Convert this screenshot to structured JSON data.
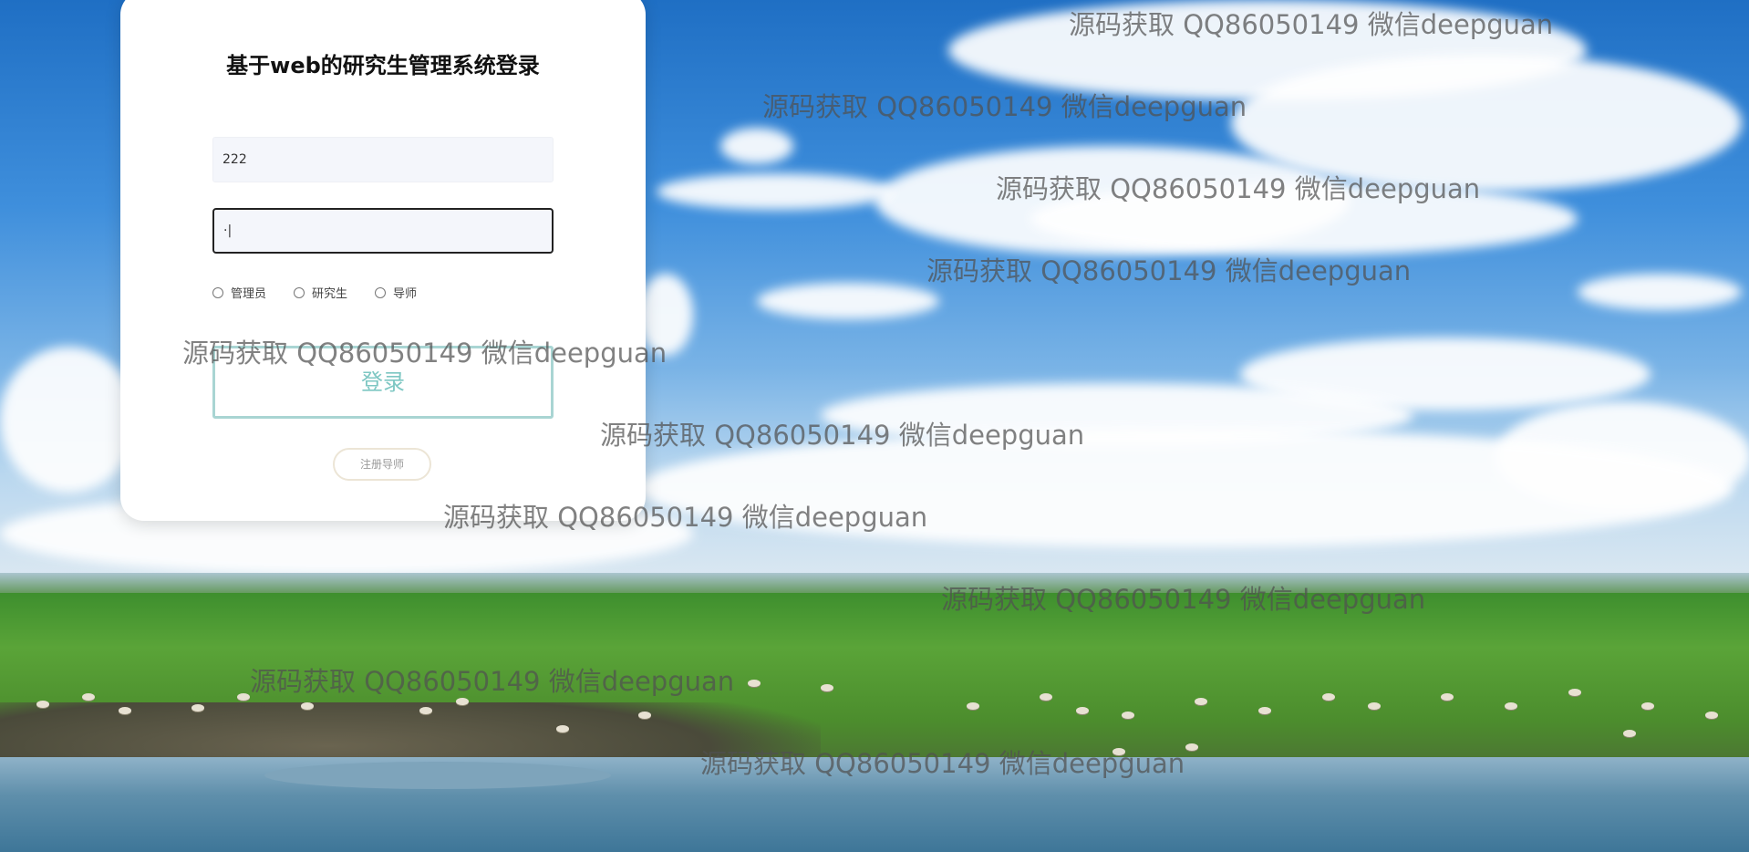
{
  "login": {
    "title": "基于web的研究生管理系统登录",
    "username_value": "222",
    "password_value": "·|",
    "roles": [
      "管理员",
      "研究生",
      "导师"
    ],
    "login_button": "登录",
    "register_button": "注册导师"
  },
  "watermark": {
    "text": "源码获取 QQ86050149 微信deepguan"
  },
  "colors": {
    "login_border": "#a9d5d3",
    "login_text": "#7ec7c3",
    "card_bg": "#ffffff"
  }
}
